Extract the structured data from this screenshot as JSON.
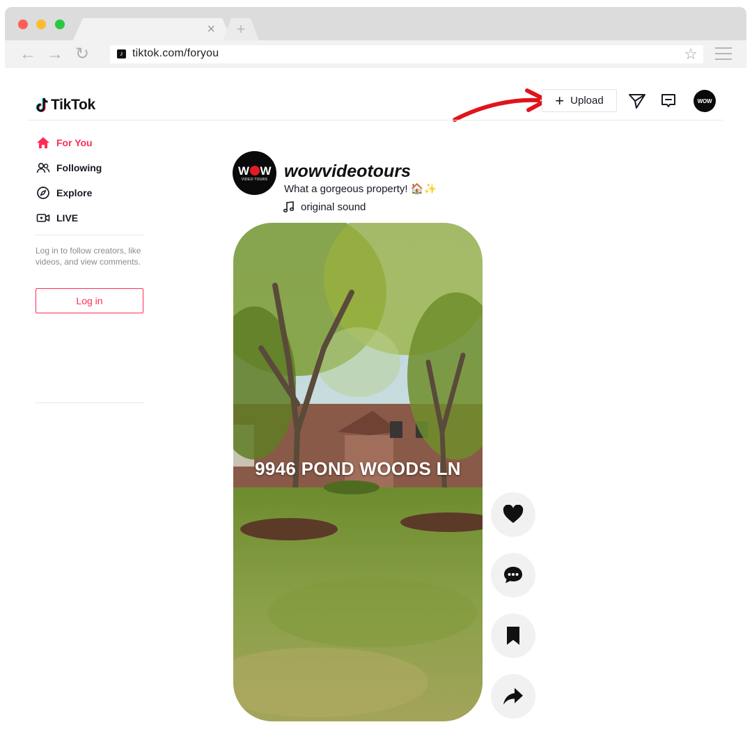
{
  "browser": {
    "url": "tiktok.com/foryou",
    "tab_close_glyph": "×",
    "new_tab_glyph": "+",
    "back_glyph": "←",
    "forward_glyph": "→",
    "reload_glyph": "↻",
    "bookmark_glyph": "☆"
  },
  "header": {
    "logo_text": "TikTok",
    "upload_plus": "+",
    "upload_label": "Upload",
    "avatar_text": "WOW",
    "icons": [
      "send-icon",
      "inbox-icon"
    ]
  },
  "sidebar": {
    "items": [
      {
        "label": "For You",
        "icon": "home-icon",
        "active": true
      },
      {
        "label": "Following",
        "icon": "people-icon",
        "active": false
      },
      {
        "label": "Explore",
        "icon": "compass-icon",
        "active": false
      },
      {
        "label": "LIVE",
        "icon": "live-camera-icon",
        "active": false
      }
    ],
    "login_hint": "Log in to follow creators, like videos, and view comments.",
    "login_button": "Log in"
  },
  "post": {
    "avatar_brand": "WOW",
    "avatar_subtitle": "VIDEO TOURS",
    "username": "wowvideotours",
    "caption": "What a gorgeous property! 🏠✨",
    "sound": "original sound",
    "video_overlay": "9946 POND WOODS LN",
    "actions": [
      "heart-icon",
      "comment-icon",
      "bookmark-icon",
      "share-icon"
    ]
  },
  "colors": {
    "accent": "#fe2c55",
    "annotation_arrow": "#e0141b",
    "action_bg": "#f1f1f2"
  }
}
